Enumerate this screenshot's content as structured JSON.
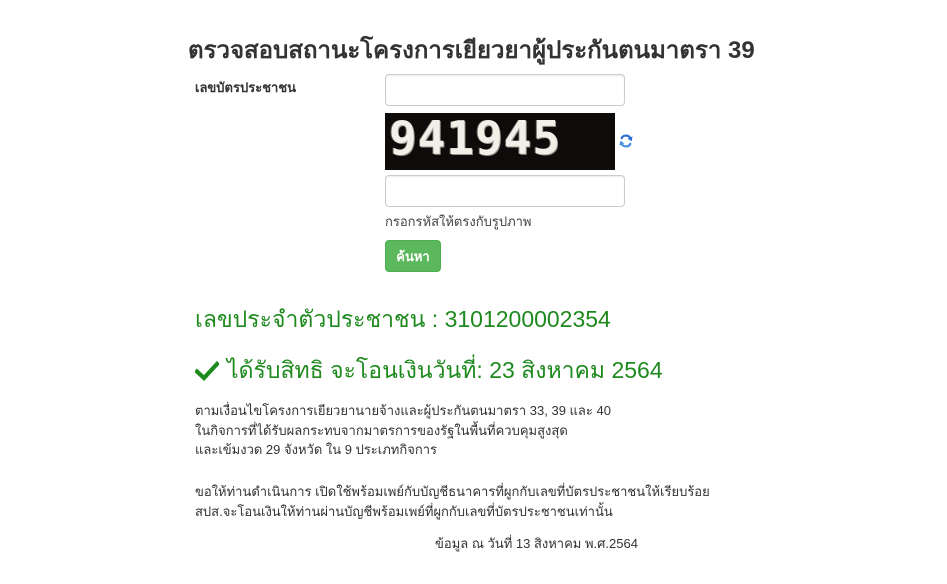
{
  "page": {
    "title": "ตรวจสอบสถานะโครงการเยียวยาผู้ประกันตนมาตรา 39"
  },
  "form": {
    "id_label": "เลขบัตรประชาชน",
    "id_value": "",
    "captcha_text": "941945",
    "captcha_value": "",
    "captcha_help": "กรอกรหัสให้ตรงกับรูปภาพ",
    "submit_label": "ค้นหา",
    "refresh_icon": "refresh-icon"
  },
  "result": {
    "id_line": "เลขประจำตัวประชาชน : 3101200002354",
    "status_icon": "checkmark-icon",
    "status_text": "ได้รับสิทธิ จะโอนเงินวันที่: 23 สิงหาคม 2564",
    "status_color": "#1e8a1e",
    "conditions": [
      "ตามเงื่อนไขโครงการเยียวยานายจ้างและผู้ประกันตนมาตรา 33, 39 และ 40",
      "ในกิจการที่ได้รับผลกระทบจากมาตรการของรัฐในพื้นที่ควบคุมสูงสุด",
      "และเข้มงวด 29 จังหวัด ใน 9 ประเภทกิจการ"
    ],
    "instructions": [
      "ขอให้ท่านดำเนินการ เปิดใช้พร้อมเพย์กับบัญชีธนาคารที่ผูกกับเลขที่บัตรประชาชนให้เรียบร้อย",
      "สปส.จะโอนเงินให้ท่านผ่านบัญชีพร้อมเพย์ที่ผูกกับเลขที่บัตรประชาชนเท่านั้น"
    ],
    "as_of": "ข้อมูล ณ วันที่ 13 สิงหาคม พ.ศ.2564"
  },
  "colors": {
    "button": "#5cb85c",
    "success_text": "#1e8a1e"
  }
}
